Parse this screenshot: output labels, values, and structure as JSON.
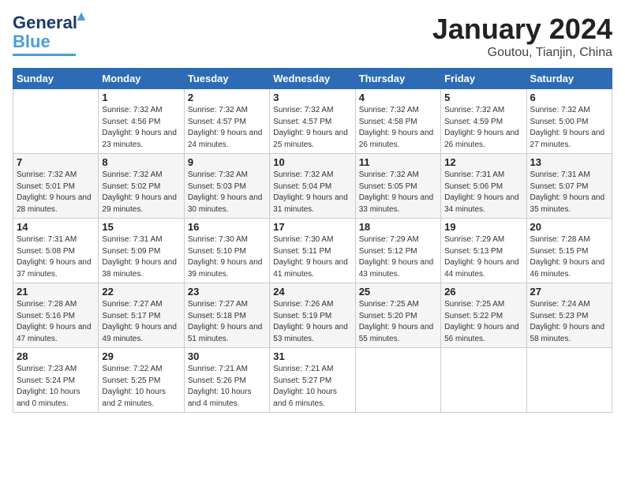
{
  "header": {
    "logo_line1": "General",
    "logo_line2": "Blue",
    "month": "January 2024",
    "location": "Goutou, Tianjin, China"
  },
  "days_of_week": [
    "Sunday",
    "Monday",
    "Tuesday",
    "Wednesday",
    "Thursday",
    "Friday",
    "Saturday"
  ],
  "weeks": [
    [
      {
        "day": "",
        "sunrise": "",
        "sunset": "",
        "daylight": ""
      },
      {
        "day": "1",
        "sunrise": "Sunrise: 7:32 AM",
        "sunset": "Sunset: 4:56 PM",
        "daylight": "Daylight: 9 hours and 23 minutes."
      },
      {
        "day": "2",
        "sunrise": "Sunrise: 7:32 AM",
        "sunset": "Sunset: 4:57 PM",
        "daylight": "Daylight: 9 hours and 24 minutes."
      },
      {
        "day": "3",
        "sunrise": "Sunrise: 7:32 AM",
        "sunset": "Sunset: 4:57 PM",
        "daylight": "Daylight: 9 hours and 25 minutes."
      },
      {
        "day": "4",
        "sunrise": "Sunrise: 7:32 AM",
        "sunset": "Sunset: 4:58 PM",
        "daylight": "Daylight: 9 hours and 26 minutes."
      },
      {
        "day": "5",
        "sunrise": "Sunrise: 7:32 AM",
        "sunset": "Sunset: 4:59 PM",
        "daylight": "Daylight: 9 hours and 26 minutes."
      },
      {
        "day": "6",
        "sunrise": "Sunrise: 7:32 AM",
        "sunset": "Sunset: 5:00 PM",
        "daylight": "Daylight: 9 hours and 27 minutes."
      }
    ],
    [
      {
        "day": "7",
        "sunrise": "Sunrise: 7:32 AM",
        "sunset": "Sunset: 5:01 PM",
        "daylight": "Daylight: 9 hours and 28 minutes."
      },
      {
        "day": "8",
        "sunrise": "Sunrise: 7:32 AM",
        "sunset": "Sunset: 5:02 PM",
        "daylight": "Daylight: 9 hours and 29 minutes."
      },
      {
        "day": "9",
        "sunrise": "Sunrise: 7:32 AM",
        "sunset": "Sunset: 5:03 PM",
        "daylight": "Daylight: 9 hours and 30 minutes."
      },
      {
        "day": "10",
        "sunrise": "Sunrise: 7:32 AM",
        "sunset": "Sunset: 5:04 PM",
        "daylight": "Daylight: 9 hours and 31 minutes."
      },
      {
        "day": "11",
        "sunrise": "Sunrise: 7:32 AM",
        "sunset": "Sunset: 5:05 PM",
        "daylight": "Daylight: 9 hours and 33 minutes."
      },
      {
        "day": "12",
        "sunrise": "Sunrise: 7:31 AM",
        "sunset": "Sunset: 5:06 PM",
        "daylight": "Daylight: 9 hours and 34 minutes."
      },
      {
        "day": "13",
        "sunrise": "Sunrise: 7:31 AM",
        "sunset": "Sunset: 5:07 PM",
        "daylight": "Daylight: 9 hours and 35 minutes."
      }
    ],
    [
      {
        "day": "14",
        "sunrise": "Sunrise: 7:31 AM",
        "sunset": "Sunset: 5:08 PM",
        "daylight": "Daylight: 9 hours and 37 minutes."
      },
      {
        "day": "15",
        "sunrise": "Sunrise: 7:31 AM",
        "sunset": "Sunset: 5:09 PM",
        "daylight": "Daylight: 9 hours and 38 minutes."
      },
      {
        "day": "16",
        "sunrise": "Sunrise: 7:30 AM",
        "sunset": "Sunset: 5:10 PM",
        "daylight": "Daylight: 9 hours and 39 minutes."
      },
      {
        "day": "17",
        "sunrise": "Sunrise: 7:30 AM",
        "sunset": "Sunset: 5:11 PM",
        "daylight": "Daylight: 9 hours and 41 minutes."
      },
      {
        "day": "18",
        "sunrise": "Sunrise: 7:29 AM",
        "sunset": "Sunset: 5:12 PM",
        "daylight": "Daylight: 9 hours and 43 minutes."
      },
      {
        "day": "19",
        "sunrise": "Sunrise: 7:29 AM",
        "sunset": "Sunset: 5:13 PM",
        "daylight": "Daylight: 9 hours and 44 minutes."
      },
      {
        "day": "20",
        "sunrise": "Sunrise: 7:28 AM",
        "sunset": "Sunset: 5:15 PM",
        "daylight": "Daylight: 9 hours and 46 minutes."
      }
    ],
    [
      {
        "day": "21",
        "sunrise": "Sunrise: 7:28 AM",
        "sunset": "Sunset: 5:16 PM",
        "daylight": "Daylight: 9 hours and 47 minutes."
      },
      {
        "day": "22",
        "sunrise": "Sunrise: 7:27 AM",
        "sunset": "Sunset: 5:17 PM",
        "daylight": "Daylight: 9 hours and 49 minutes."
      },
      {
        "day": "23",
        "sunrise": "Sunrise: 7:27 AM",
        "sunset": "Sunset: 5:18 PM",
        "daylight": "Daylight: 9 hours and 51 minutes."
      },
      {
        "day": "24",
        "sunrise": "Sunrise: 7:26 AM",
        "sunset": "Sunset: 5:19 PM",
        "daylight": "Daylight: 9 hours and 53 minutes."
      },
      {
        "day": "25",
        "sunrise": "Sunrise: 7:25 AM",
        "sunset": "Sunset: 5:20 PM",
        "daylight": "Daylight: 9 hours and 55 minutes."
      },
      {
        "day": "26",
        "sunrise": "Sunrise: 7:25 AM",
        "sunset": "Sunset: 5:22 PM",
        "daylight": "Daylight: 9 hours and 56 minutes."
      },
      {
        "day": "27",
        "sunrise": "Sunrise: 7:24 AM",
        "sunset": "Sunset: 5:23 PM",
        "daylight": "Daylight: 9 hours and 58 minutes."
      }
    ],
    [
      {
        "day": "28",
        "sunrise": "Sunrise: 7:23 AM",
        "sunset": "Sunset: 5:24 PM",
        "daylight": "Daylight: 10 hours and 0 minutes."
      },
      {
        "day": "29",
        "sunrise": "Sunrise: 7:22 AM",
        "sunset": "Sunset: 5:25 PM",
        "daylight": "Daylight: 10 hours and 2 minutes."
      },
      {
        "day": "30",
        "sunrise": "Sunrise: 7:21 AM",
        "sunset": "Sunset: 5:26 PM",
        "daylight": "Daylight: 10 hours and 4 minutes."
      },
      {
        "day": "31",
        "sunrise": "Sunrise: 7:21 AM",
        "sunset": "Sunset: 5:27 PM",
        "daylight": "Daylight: 10 hours and 6 minutes."
      },
      {
        "day": "",
        "sunrise": "",
        "sunset": "",
        "daylight": ""
      },
      {
        "day": "",
        "sunrise": "",
        "sunset": "",
        "daylight": ""
      },
      {
        "day": "",
        "sunrise": "",
        "sunset": "",
        "daylight": ""
      }
    ]
  ]
}
